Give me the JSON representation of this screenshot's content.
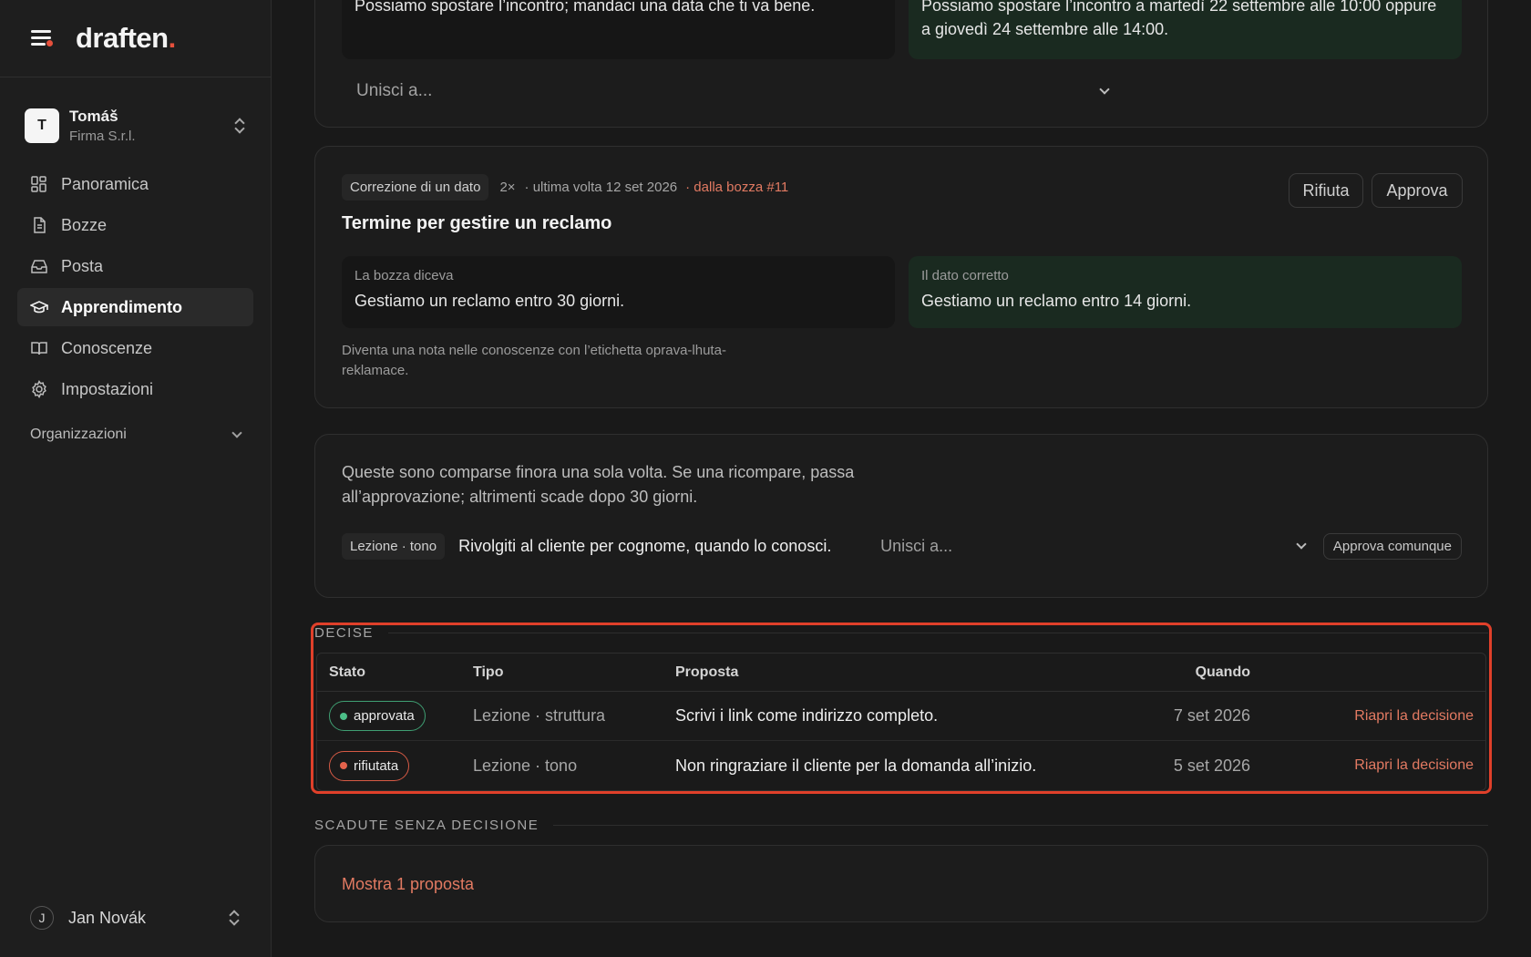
{
  "brand": {
    "name": "draften",
    "dot": "."
  },
  "account": {
    "initial": "T",
    "name": "Tomáš",
    "company": "Firma S.r.l."
  },
  "nav": [
    {
      "label": "Panoramica",
      "icon": "dashboard-icon"
    },
    {
      "label": "Bozze",
      "icon": "document-icon"
    },
    {
      "label": "Posta",
      "icon": "inbox-icon"
    },
    {
      "label": "Apprendimento",
      "icon": "graduation-cap-icon",
      "active": true
    },
    {
      "label": "Conoscenze",
      "icon": "book-icon"
    },
    {
      "label": "Impostazioni",
      "icon": "gear-icon"
    }
  ],
  "organizations": {
    "label": "Organizzazioni"
  },
  "user": {
    "initial": "J",
    "name": "Jan Novák"
  },
  "card1": {
    "old_text": "Possiamo spostare l’incontro; mandaci una data che ti va bene.",
    "new_text": "Possiamo spostare l’incontro a martedì 22 settembre alle 10:00 oppure a giovedì 24 settembre alle 14:00.",
    "merge_placeholder": "Unisci a..."
  },
  "card2": {
    "tag": "Correzione di un dato",
    "count": "2×",
    "last_time": "· ultima volta 12 set 2026",
    "source": "· dalla bozza #11",
    "reject_label": "Rifiuta",
    "approve_label": "Approva",
    "title": "Termine per gestire un reclamo",
    "old_caption": "La bozza diceva",
    "old_text": "Gestiamo un reclamo entro 30 giorni.",
    "new_caption": "Il dato corretto",
    "new_text": "Gestiamo un reclamo entro 14 giorni.",
    "note": "Diventa una nota nelle conoscenze con l’etichetta oprava-lhuta-reklamace."
  },
  "card3": {
    "info": "Queste sono comparse finora una sola volta. Se una ricompare, passa all’approvazione; altrimenti scade dopo 30 giorni.",
    "tag": "Lezione · tono",
    "lesson_text": "Rivolgiti al cliente per cognome, quando lo conosci.",
    "merge_placeholder": "Unisci a...",
    "approve_anyway": "Approva comunque"
  },
  "decided": {
    "section_label": "DECISE",
    "columns": {
      "stato": "Stato",
      "tipo": "Tipo",
      "proposta": "Proposta",
      "quando": "Quando"
    },
    "rows": [
      {
        "status": "approvata",
        "status_kind": "approved",
        "type": "Lezione · struttura",
        "proposal": "Scrivi i link come indirizzo completo.",
        "when": "7 set 2026",
        "action": "Riapri la decisione"
      },
      {
        "status": "rifiutata",
        "status_kind": "rejected",
        "type": "Lezione · tono",
        "proposal": "Non ringraziare il cliente per la domanda all’inizio.",
        "when": "5 set 2026",
        "action": "Riapri la decisione"
      }
    ]
  },
  "expired": {
    "section_label": "SCADUTE SENZA DECISIONE",
    "show_more": "Mostra 1 proposta"
  },
  "colors": {
    "accent": "#e27a62",
    "brand_dot": "#e5503c",
    "approved": "#4cbf88",
    "rejected": "#e5634c",
    "highlight": "#e0402a"
  }
}
